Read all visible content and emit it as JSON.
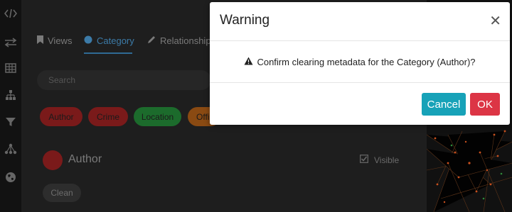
{
  "sidebar": {
    "icons": [
      "code-icon",
      "arrows-icon",
      "table-icon",
      "hierarchy-icon",
      "filter-icon",
      "network-icon",
      "globe-icon"
    ]
  },
  "tabs": [
    {
      "label": "Views",
      "icon": "bookmark-icon"
    },
    {
      "label": "Category",
      "icon": "circle-icon",
      "active": true
    },
    {
      "label": "Relationship",
      "icon": "pencil-icon"
    }
  ],
  "search": {
    "placeholder": "Search"
  },
  "chips": [
    {
      "label": "Author",
      "color": "#7a1a1a"
    },
    {
      "label": "Crime",
      "color": "#7a1a1a"
    },
    {
      "label": "Location",
      "color": "#1c6b2c"
    },
    {
      "label": "Offi",
      "color": "#8a4a12"
    }
  ],
  "category": {
    "name": "Author",
    "color": "#7a1a1a",
    "visible_label": "Visible",
    "clean_label": "Clean"
  },
  "modal": {
    "title": "Warning",
    "message": "Confirm clearing metadata for the Category (Author)?",
    "cancel_label": "Cancel",
    "ok_label": "OK",
    "cancel_color": "#17a2b8",
    "ok_color": "#dc3545"
  }
}
